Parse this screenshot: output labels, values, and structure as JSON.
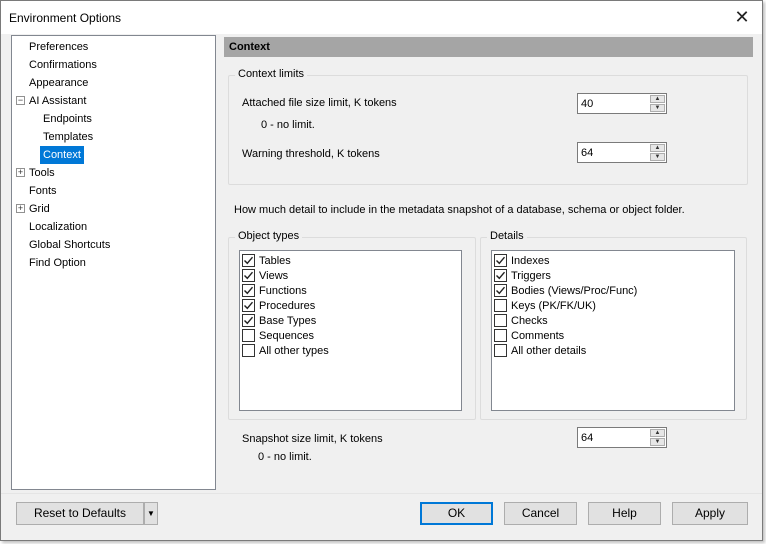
{
  "window": {
    "title": "Environment Options",
    "close_glyph": "✕"
  },
  "tree": {
    "items": [
      {
        "label": "Preferences",
        "expander": ""
      },
      {
        "label": "Confirmations",
        "expander": ""
      },
      {
        "label": "Appearance",
        "expander": ""
      },
      {
        "label": "AI Assistant",
        "expander": "−"
      },
      {
        "label": "Endpoints",
        "expander": ""
      },
      {
        "label": "Templates",
        "expander": ""
      },
      {
        "label": "Context",
        "expander": "",
        "selected": true
      },
      {
        "label": "Tools",
        "expander": "+"
      },
      {
        "label": "Fonts",
        "expander": ""
      },
      {
        "label": "Grid",
        "expander": "+"
      },
      {
        "label": "Localization",
        "expander": ""
      },
      {
        "label": "Global Shortcuts",
        "expander": ""
      },
      {
        "label": "Find Option",
        "expander": ""
      }
    ]
  },
  "section": {
    "title": "Context"
  },
  "context_limits": {
    "legend": "Context limits",
    "attached_label": "Attached file size limit, K tokens",
    "attached_value": "40",
    "attached_hint": "0 - no limit.",
    "warning_label": "Warning threshold, K tokens",
    "warning_value": "64"
  },
  "metadata_note": "How much detail to include in the metadata snapshot of a database, schema or object folder.",
  "object_types": {
    "legend": "Object types",
    "items": [
      {
        "label": "Tables",
        "checked": true
      },
      {
        "label": "Views",
        "checked": true
      },
      {
        "label": "Functions",
        "checked": true
      },
      {
        "label": "Procedures",
        "checked": true
      },
      {
        "label": "Base Types",
        "checked": true
      },
      {
        "label": "Sequences",
        "checked": false
      },
      {
        "label": "All other types",
        "checked": false
      }
    ]
  },
  "details": {
    "legend": "Details",
    "items": [
      {
        "label": "Indexes",
        "checked": true
      },
      {
        "label": "Triggers",
        "checked": true
      },
      {
        "label": "Bodies (Views/Proc/Func)",
        "checked": true
      },
      {
        "label": "Keys (PK/FK/UK)",
        "checked": false
      },
      {
        "label": "Checks",
        "checked": false
      },
      {
        "label": "Comments",
        "checked": false
      },
      {
        "label": "All other details",
        "checked": false
      }
    ]
  },
  "snapshot": {
    "label": "Snapshot size limit, K tokens",
    "value": "64",
    "hint": "0 - no limit."
  },
  "buttons": {
    "reset": "Reset to Defaults",
    "ok": "OK",
    "cancel": "Cancel",
    "help": "Help",
    "apply": "Apply"
  },
  "colors": {
    "selection": "#0078d7",
    "header_bar": "#a5a5a5",
    "dialog_bg": "#f0f0f0"
  }
}
